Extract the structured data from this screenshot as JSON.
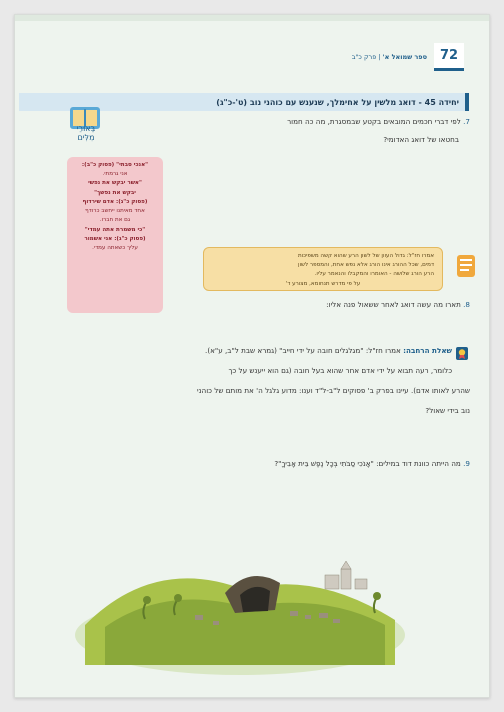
{
  "page": {
    "number": "72",
    "book": "ספר שמואל א'",
    "chapter": "פרק כ\"ב"
  },
  "unit_title": "יחידה 45 - דואג מלשין על אחימלך, שנענש עם כוהני נוב (ט'-כ\"ג)",
  "q7": {
    "num": "7.",
    "line1": "לפי דברי חכמים המובאים בקטע שבמסגרת, מה כה חמור",
    "line2": "בחטאו של דואג האדומי?"
  },
  "biur": {
    "line1": "בֵּאוּרֵי",
    "line2": "מִלִּים"
  },
  "gloss": {
    "l1": "\"אנכי סבתי\" (פסוק כ\"ב):",
    "l2": "אני גרמתי.",
    "l3": "\"אשר יבקש את נפשי",
    "l4": "יבקש את נפשך\"",
    "l5": "(פסוק כ\"ג): אדם שירדוף",
    "l6": "אחד מאיתנו ייחשב כרודף",
    "l7": "גם את חברו.",
    "l8": "\"כי משמרת אתה עמדי\"",
    "l9": "(פסוק כ\"ג): אני אשמור",
    "l10": "עליך כשאתה עמדי."
  },
  "quote": {
    "l1": "אמרו חז\"ל: גדול העוון של לשון הרע שהוא קשה משפיכות",
    "l2": "דמים, שכל ההורג אינו הורג אלא נפש אחת, והמספר לשון",
    "l3": "הרע הורג שלושה - האומרו והמקבלו והנאמר עליו.",
    "l4": "על פי מדרש תנחומא, מצורע ד'"
  },
  "q8": {
    "num": "8.",
    "text": "תארו מה עשה דואג לאחר ששאול פנה אליו:"
  },
  "expand": {
    "label": "שאלת הרחבה:",
    "l1": "אמרו חז\"ל: \"מגלגלים חובה על ידי חייב\" (גמרא שבת ל\"ב, ע\"א).",
    "l2": "כלומר, רעה תבוא על ידי אדם אחר שהוא בעל חובה (גם הוא ייענש על כך",
    "l3": "שהרע לאותו אדם). עיינו בפרק ב' פסוקים ל\"ב-ל\"ד וענו: מדוע גלגל ה' את מותם של כוהני",
    "l4": "נוב בידי שאול?"
  },
  "q9": {
    "num": "9.",
    "text": "מה הייתה כוונת דוד במילים: \"אָנֹכִי סַבֹּתִי בְּכָל נֶפֶשׁ בֵּית אָבִיךָ\"?"
  },
  "colors": {
    "accent": "#1f5f8b",
    "gloss_bg": "#f3c8cc",
    "quote_bg": "#f7dfa5"
  }
}
